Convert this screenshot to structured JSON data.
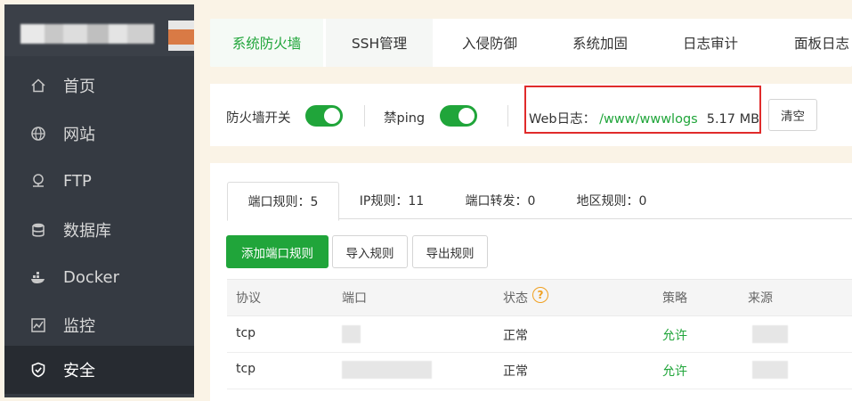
{
  "sidebar": {
    "items": [
      {
        "label": "首页",
        "icon": "home-icon"
      },
      {
        "label": "网站",
        "icon": "globe-icon"
      },
      {
        "label": "FTP",
        "icon": "ftp-icon"
      },
      {
        "label": "数据库",
        "icon": "database-icon"
      },
      {
        "label": "Docker",
        "icon": "docker-icon"
      },
      {
        "label": "监控",
        "icon": "monitor-icon"
      },
      {
        "label": "安全",
        "icon": "shield-icon"
      }
    ],
    "active_index": 6
  },
  "top_tabs": [
    "系统防火墙",
    "SSH管理",
    "入侵防御",
    "系统加固",
    "日志审计",
    "面板日志"
  ],
  "toolbar": {
    "firewall_switch_label": "防火墙开关",
    "firewall_on": true,
    "ping_switch_label": "禁ping",
    "ping_on": true,
    "weblog_label": "Web日志：",
    "weblog_path": "/www/wwwlogs",
    "weblog_size": "5.17 MB",
    "clear_button": "清空"
  },
  "sub_tabs": [
    "端口规则：5",
    "IP规则：11",
    "端口转发：0",
    "地区规则：0"
  ],
  "actions": {
    "add_port_rule": "添加端口规则",
    "import_rules": "导入规则",
    "export_rules": "导出规则"
  },
  "table": {
    "columns": [
      "协议",
      "端口",
      "状态",
      "策略",
      "来源"
    ],
    "rows": [
      {
        "protocol": "tcp",
        "port": "",
        "status": "正常",
        "policy": "允许",
        "source": ""
      },
      {
        "protocol": "tcp",
        "port": "",
        "status": "正常",
        "policy": "允许",
        "source": ""
      }
    ]
  },
  "colors": {
    "accent": "#20a53a",
    "highlight_border": "#e02b2b",
    "sidebar_bg": "#353a42",
    "help_icon": "#f0a020"
  }
}
